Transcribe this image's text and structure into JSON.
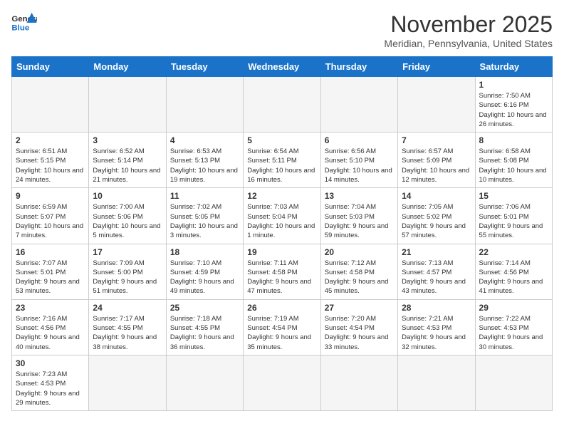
{
  "logo": {
    "text_general": "General",
    "text_blue": "Blue"
  },
  "title": "November 2025",
  "subtitle": "Meridian, Pennsylvania, United States",
  "weekdays": [
    "Sunday",
    "Monday",
    "Tuesday",
    "Wednesday",
    "Thursday",
    "Friday",
    "Saturday"
  ],
  "weeks": [
    [
      {
        "day": "",
        "info": ""
      },
      {
        "day": "",
        "info": ""
      },
      {
        "day": "",
        "info": ""
      },
      {
        "day": "",
        "info": ""
      },
      {
        "day": "",
        "info": ""
      },
      {
        "day": "",
        "info": ""
      },
      {
        "day": "1",
        "info": "Sunrise: 7:50 AM\nSunset: 6:16 PM\nDaylight: 10 hours and 26 minutes."
      }
    ],
    [
      {
        "day": "2",
        "info": "Sunrise: 6:51 AM\nSunset: 5:15 PM\nDaylight: 10 hours and 24 minutes."
      },
      {
        "day": "3",
        "info": "Sunrise: 6:52 AM\nSunset: 5:14 PM\nDaylight: 10 hours and 21 minutes."
      },
      {
        "day": "4",
        "info": "Sunrise: 6:53 AM\nSunset: 5:13 PM\nDaylight: 10 hours and 19 minutes."
      },
      {
        "day": "5",
        "info": "Sunrise: 6:54 AM\nSunset: 5:11 PM\nDaylight: 10 hours and 16 minutes."
      },
      {
        "day": "6",
        "info": "Sunrise: 6:56 AM\nSunset: 5:10 PM\nDaylight: 10 hours and 14 minutes."
      },
      {
        "day": "7",
        "info": "Sunrise: 6:57 AM\nSunset: 5:09 PM\nDaylight: 10 hours and 12 minutes."
      },
      {
        "day": "8",
        "info": "Sunrise: 6:58 AM\nSunset: 5:08 PM\nDaylight: 10 hours and 10 minutes."
      }
    ],
    [
      {
        "day": "9",
        "info": "Sunrise: 6:59 AM\nSunset: 5:07 PM\nDaylight: 10 hours and 7 minutes."
      },
      {
        "day": "10",
        "info": "Sunrise: 7:00 AM\nSunset: 5:06 PM\nDaylight: 10 hours and 5 minutes."
      },
      {
        "day": "11",
        "info": "Sunrise: 7:02 AM\nSunset: 5:05 PM\nDaylight: 10 hours and 3 minutes."
      },
      {
        "day": "12",
        "info": "Sunrise: 7:03 AM\nSunset: 5:04 PM\nDaylight: 10 hours and 1 minute."
      },
      {
        "day": "13",
        "info": "Sunrise: 7:04 AM\nSunset: 5:03 PM\nDaylight: 9 hours and 59 minutes."
      },
      {
        "day": "14",
        "info": "Sunrise: 7:05 AM\nSunset: 5:02 PM\nDaylight: 9 hours and 57 minutes."
      },
      {
        "day": "15",
        "info": "Sunrise: 7:06 AM\nSunset: 5:01 PM\nDaylight: 9 hours and 55 minutes."
      }
    ],
    [
      {
        "day": "16",
        "info": "Sunrise: 7:07 AM\nSunset: 5:01 PM\nDaylight: 9 hours and 53 minutes."
      },
      {
        "day": "17",
        "info": "Sunrise: 7:09 AM\nSunset: 5:00 PM\nDaylight: 9 hours and 51 minutes."
      },
      {
        "day": "18",
        "info": "Sunrise: 7:10 AM\nSunset: 4:59 PM\nDaylight: 9 hours and 49 minutes."
      },
      {
        "day": "19",
        "info": "Sunrise: 7:11 AM\nSunset: 4:58 PM\nDaylight: 9 hours and 47 minutes."
      },
      {
        "day": "20",
        "info": "Sunrise: 7:12 AM\nSunset: 4:58 PM\nDaylight: 9 hours and 45 minutes."
      },
      {
        "day": "21",
        "info": "Sunrise: 7:13 AM\nSunset: 4:57 PM\nDaylight: 9 hours and 43 minutes."
      },
      {
        "day": "22",
        "info": "Sunrise: 7:14 AM\nSunset: 4:56 PM\nDaylight: 9 hours and 41 minutes."
      }
    ],
    [
      {
        "day": "23",
        "info": "Sunrise: 7:16 AM\nSunset: 4:56 PM\nDaylight: 9 hours and 40 minutes."
      },
      {
        "day": "24",
        "info": "Sunrise: 7:17 AM\nSunset: 4:55 PM\nDaylight: 9 hours and 38 minutes."
      },
      {
        "day": "25",
        "info": "Sunrise: 7:18 AM\nSunset: 4:55 PM\nDaylight: 9 hours and 36 minutes."
      },
      {
        "day": "26",
        "info": "Sunrise: 7:19 AM\nSunset: 4:54 PM\nDaylight: 9 hours and 35 minutes."
      },
      {
        "day": "27",
        "info": "Sunrise: 7:20 AM\nSunset: 4:54 PM\nDaylight: 9 hours and 33 minutes."
      },
      {
        "day": "28",
        "info": "Sunrise: 7:21 AM\nSunset: 4:53 PM\nDaylight: 9 hours and 32 minutes."
      },
      {
        "day": "29",
        "info": "Sunrise: 7:22 AM\nSunset: 4:53 PM\nDaylight: 9 hours and 30 minutes."
      }
    ],
    [
      {
        "day": "30",
        "info": "Sunrise: 7:23 AM\nSunset: 4:53 PM\nDaylight: 9 hours and 29 minutes."
      },
      {
        "day": "",
        "info": ""
      },
      {
        "day": "",
        "info": ""
      },
      {
        "day": "",
        "info": ""
      },
      {
        "day": "",
        "info": ""
      },
      {
        "day": "",
        "info": ""
      },
      {
        "day": "",
        "info": ""
      }
    ]
  ]
}
